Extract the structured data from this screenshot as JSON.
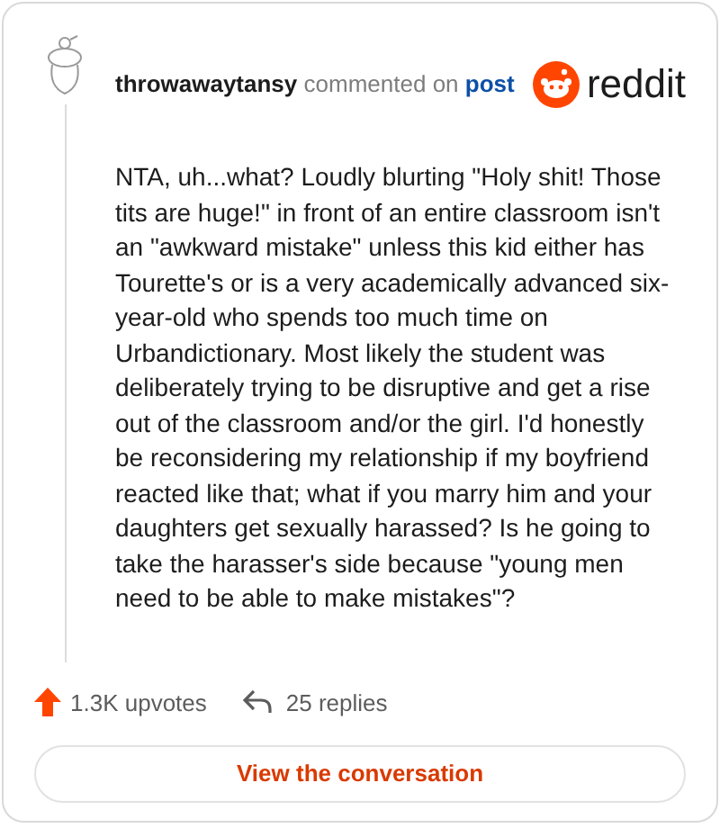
{
  "header": {
    "username": "throwawaytansy",
    "action": "commented on",
    "link": "post",
    "logo_text": "reddit"
  },
  "comment": {
    "body": "NTA, uh...what? Loudly blurting \"Holy shit! Those tits are huge!\" in front of an entire classroom isn't an \"awkward mistake\" unless this kid either has Tourette's or is a very academically advanced six-year-old who spends too much time on Urbandictionary. Most likely the student was deliberately trying to be disruptive and get a rise out of the classroom and/or the girl. I'd honestly be reconsidering my relationship if my boyfriend reacted like that; what if you marry him and your daughters get sexually harassed? Is he going to take the harasser's side because \"young men need to be able to make mistakes\"?"
  },
  "stats": {
    "upvotes": "1.3K upvotes",
    "replies": "25 replies"
  },
  "button": {
    "label": "View the conversation"
  }
}
